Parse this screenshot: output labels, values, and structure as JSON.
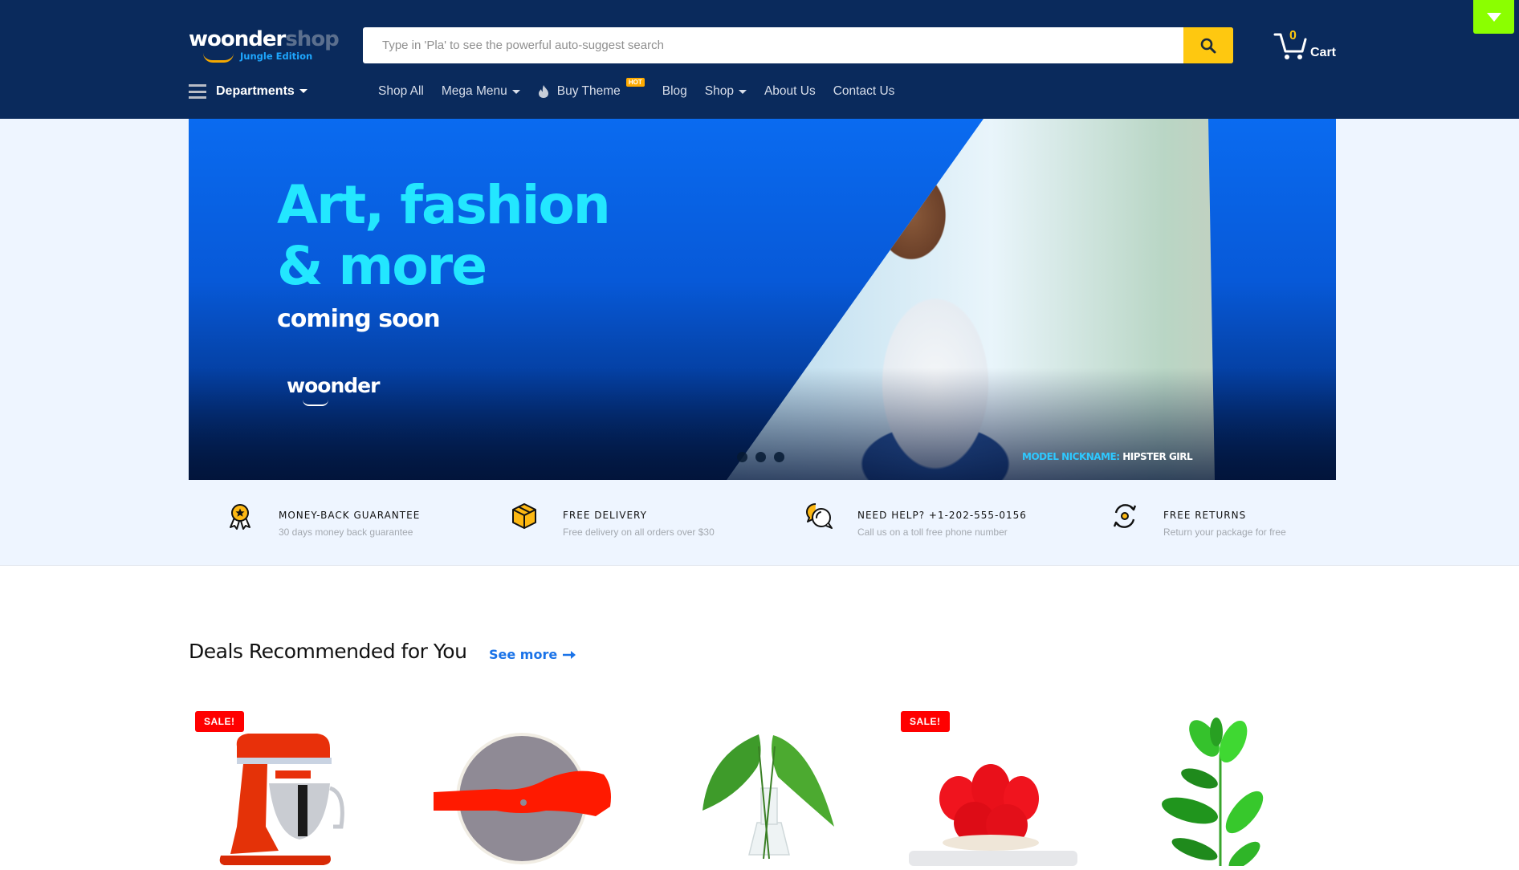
{
  "header": {
    "logo": {
      "brand_main": "woonder",
      "brand_accent": "shop",
      "edition": "Jungle Edition"
    },
    "search": {
      "placeholder": "Type in 'Pla' to see the powerful auto-suggest search",
      "value": "",
      "button_icon": "search-icon"
    },
    "cart": {
      "count": "0",
      "label": "Cart",
      "icon": "cart-icon"
    },
    "corner_toggle_icon": "caret-down-icon",
    "departments_label": "Departments",
    "menu": [
      {
        "label": "Shop All",
        "has_dropdown": false
      },
      {
        "label": "Mega Menu",
        "has_dropdown": true
      },
      {
        "label": "Buy Theme",
        "has_dropdown": false,
        "badge": "HOT",
        "icon": "flame-icon"
      },
      {
        "label": "Blog",
        "has_dropdown": false
      },
      {
        "label": "Shop",
        "has_dropdown": true
      },
      {
        "label": "About Us",
        "has_dropdown": false
      },
      {
        "label": "Contact Us",
        "has_dropdown": false
      }
    ]
  },
  "banner": {
    "headline_line1": "Art, fashion",
    "headline_line2": "& more",
    "subheadline": "coming soon",
    "brand": "woonder",
    "caption_key": "MODEL NICKNAME:",
    "caption_value": "HIPSTER GIRL",
    "slides": 3,
    "colors": {
      "headline": "#23e7ff",
      "caption_key": "#2ec8ff"
    }
  },
  "features": [
    {
      "icon": "award-ribbon-icon",
      "title": "MONEY-BACK GUARANTEE",
      "subtitle": "30 days money back guarantee"
    },
    {
      "icon": "package-box-icon",
      "title": "FREE DELIVERY",
      "subtitle": "Free delivery on all orders over $30"
    },
    {
      "icon": "chat-bubbles-icon",
      "title": "NEED HELP? +1-202-555-0156",
      "subtitle": "Call us on a toll free phone number"
    },
    {
      "icon": "returns-cycle-icon",
      "title": "FREE RETURNS",
      "subtitle": "Return your package for free"
    }
  ],
  "deals": {
    "title": "Deals Recommended for You",
    "see_more": "See more",
    "products": [
      {
        "image": "red stand mixer",
        "badge": "SALE!"
      },
      {
        "image": "pizza cutter wheel",
        "badge": ""
      },
      {
        "image": "leaves in glass vase",
        "badge": ""
      },
      {
        "image": "red cactus in pot",
        "badge": "SALE!"
      },
      {
        "image": "green rubber plant",
        "badge": ""
      }
    ]
  },
  "colors": {
    "header_bg": "#0a2a5c",
    "search_button": "#fec810",
    "corner_toggle": "#8bff00",
    "sale_badge": "#ff0000",
    "link": "#1a73e8",
    "hot_badge": "#ffab00"
  }
}
